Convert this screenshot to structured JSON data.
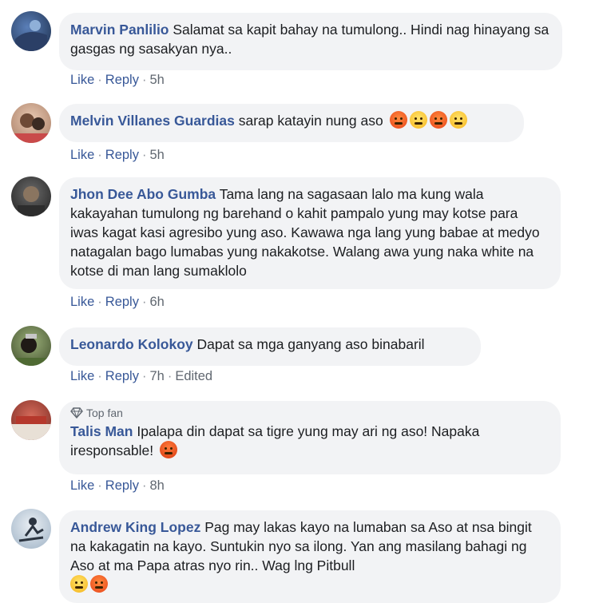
{
  "actions": {
    "like": "Like",
    "reply": "Reply",
    "separator": "·"
  },
  "comments": [
    {
      "author": "Marvin Panlilio",
      "text": "Salamat sa kapit bahay na tumulong.. Hindi nag hinayang sa gasgas ng sasakyan nya..",
      "time": "5h"
    },
    {
      "author": "Melvin Villanes Guardias",
      "text": "sarap katayin nung aso",
      "emojis": [
        "angry-face",
        "steam-face",
        "angry-face",
        "steam-face"
      ],
      "time": "5h"
    },
    {
      "author": "Jhon Dee Abo Gumba",
      "text": "Tama lang na sagasaan lalo ma kung wala kakayahan tumulong ng barehand o kahit pampalo yung may kotse para iwas kagat kasi agresibo yung aso. Kawawa nga lang yung babae at medyo natagalan bago lumabas yung nakakotse. Walang awa yung naka white na kotse di man lang sumaklolo",
      "time": "6h"
    },
    {
      "author": "Leonardo Kolokoy",
      "text": "Dapat sa mga ganyang aso binabaril",
      "time": "7h",
      "edited": "Edited"
    },
    {
      "badge": "Top fan",
      "author": "Talis Man",
      "text": "Ipalapa din dapat sa tigre yung may ari ng aso! Napaka iresponsable!",
      "emojis": [
        "cursing-face"
      ],
      "time": "8h"
    },
    {
      "author": "Andrew King Lopez",
      "text": "Pag may lakas kayo na lumaban sa Aso at nsa bingit na kakagatin na kayo. Suntukin nyo sa ilong. Yan ang masilang bahagi ng Aso at ma Papa atras nyo rin.. Wag lng Pitbull",
      "emojis": [
        "grimacing-face",
        "angry-face"
      ]
    }
  ]
}
